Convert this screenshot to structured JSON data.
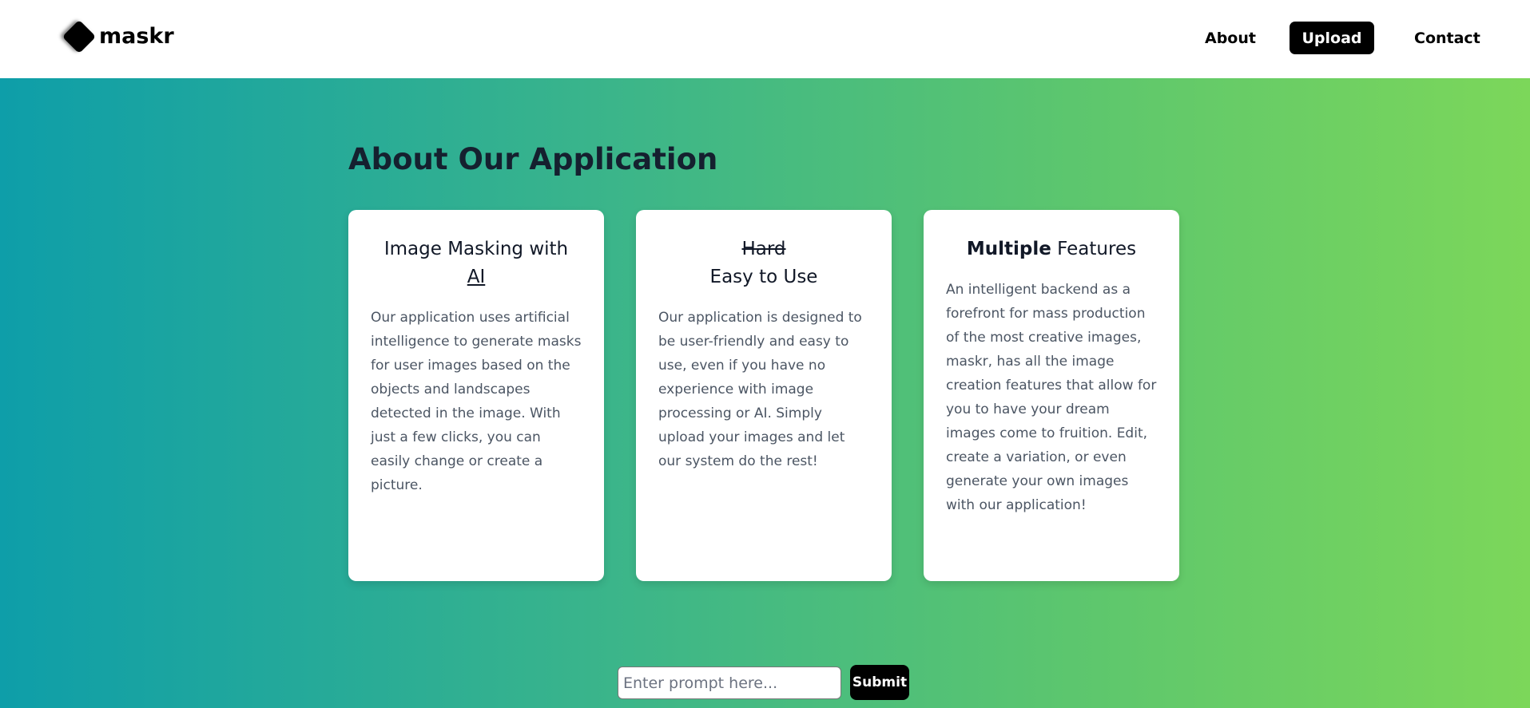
{
  "header": {
    "logo_text": "maskr",
    "nav": {
      "about": "About",
      "upload": "Upload",
      "contact": "Contact"
    }
  },
  "main": {
    "title": "About Our Application",
    "cards": [
      {
        "title_prefix": "Image Masking with",
        "title_emphasis": "AI",
        "body": "Our application uses artificial intelligence to generate masks for user images based on the objects and landscapes detected in the image. With just a few clicks, you can easily change or create a picture."
      },
      {
        "title_struck": "Hard",
        "title": "Easy to Use",
        "body": "Our application is designed to be user-friendly and easy to use, even if you have no experience with image processing or AI. Simply upload your images and let our system do the rest!"
      },
      {
        "title_bold": "Multiple",
        "title_rest": " Features",
        "body": "An intelligent backend as a forefront for mass production of the most creative images, maskr, has all the image creation features that allow for you to have your dream images come to fruition. Edit, create a variation, or even generate your own images with our application!"
      }
    ]
  },
  "prompt": {
    "placeholder": "Enter prompt here...",
    "value": "",
    "submit_label": "Submit"
  }
}
